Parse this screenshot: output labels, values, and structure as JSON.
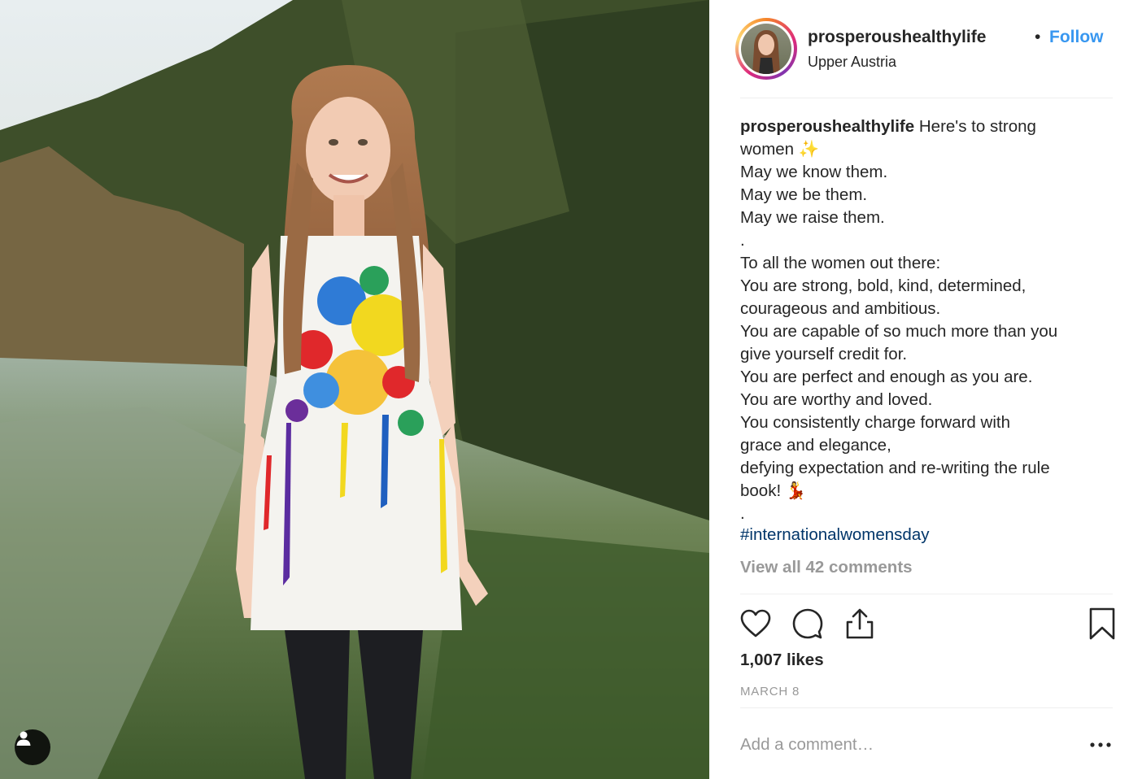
{
  "post": {
    "username": "prosperoushealthylife",
    "separator": "•",
    "follow_label": "Follow",
    "location": "Upper Austria",
    "caption_user": "prosperoushealthylife",
    "caption_text": " Here's to strong\nwomen ✨\nMay we know them.\nMay we be them.\nMay we raise them.\n.\nTo all the women out there:\nYou are strong, bold, kind, determined,\ncourageous and ambitious.\nYou are capable of so much more than you\ngive yourself credit for.\nYou are perfect and enough as you are.\nYou are worthy and loved.\nYou consistently charge forward with\ngrace and elegance,\ndefying expectation and re-writing the rule\nbook! 💃\n.",
    "hashtag": "#internationalwomensday",
    "view_comments": "View all 42 comments",
    "likes": "1,007 likes",
    "date": "MARCH 8",
    "comment_placeholder": "Add a comment…"
  },
  "icons": {
    "like": "heart-icon",
    "comment": "comment-icon",
    "share": "share-icon",
    "save": "bookmark-icon",
    "more": "more-options-icon",
    "user_tag": "user-tag-icon"
  },
  "colors": {
    "follow": "#3897f0",
    "hashtag": "#003569",
    "muted": "#999999",
    "text": "#262626"
  }
}
